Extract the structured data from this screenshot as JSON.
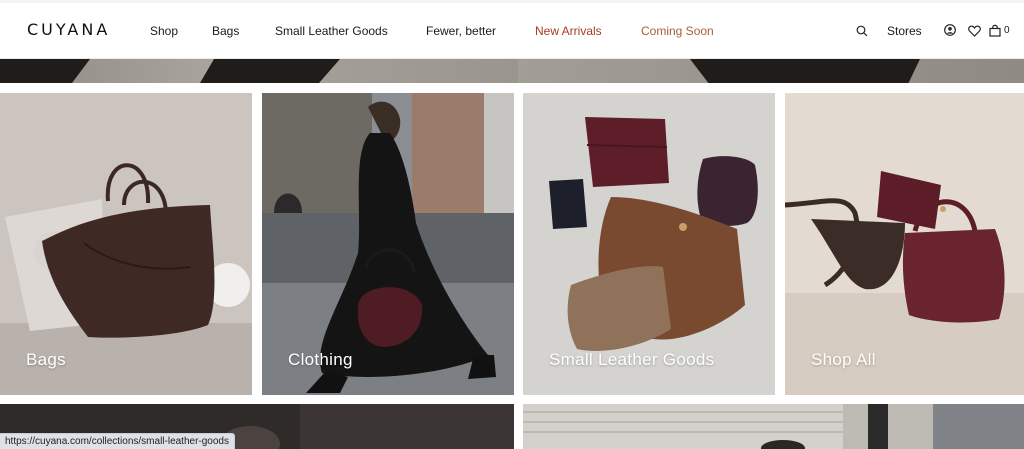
{
  "brand": {
    "logo_text": "CUYANA"
  },
  "nav": {
    "items": [
      {
        "label": "Shop"
      },
      {
        "label": "Bags"
      },
      {
        "label": "Small Leather Goods"
      },
      {
        "label": "Fewer, better"
      },
      {
        "label": "New Arrivals"
      },
      {
        "label": "Coming Soon"
      }
    ]
  },
  "utility": {
    "search_icon": "search-icon",
    "stores_label": "Stores",
    "account_icon": "account-icon",
    "wishlist_icon": "heart-icon",
    "cart_icon": "shopping-bag-icon",
    "cart_count": "0"
  },
  "tiles": [
    {
      "label": "Bags"
    },
    {
      "label": "Clothing"
    },
    {
      "label": "Small Leather Goods"
    },
    {
      "label": "Shop All"
    }
  ],
  "status_bar": {
    "url": "https://cuyana.com/collections/small-leather-goods"
  },
  "colors": {
    "accent_new": "#a43d1f",
    "accent_soon": "#a85d37",
    "leather_burgundy": "#6a2430",
    "leather_brown": "#7a4a30"
  }
}
